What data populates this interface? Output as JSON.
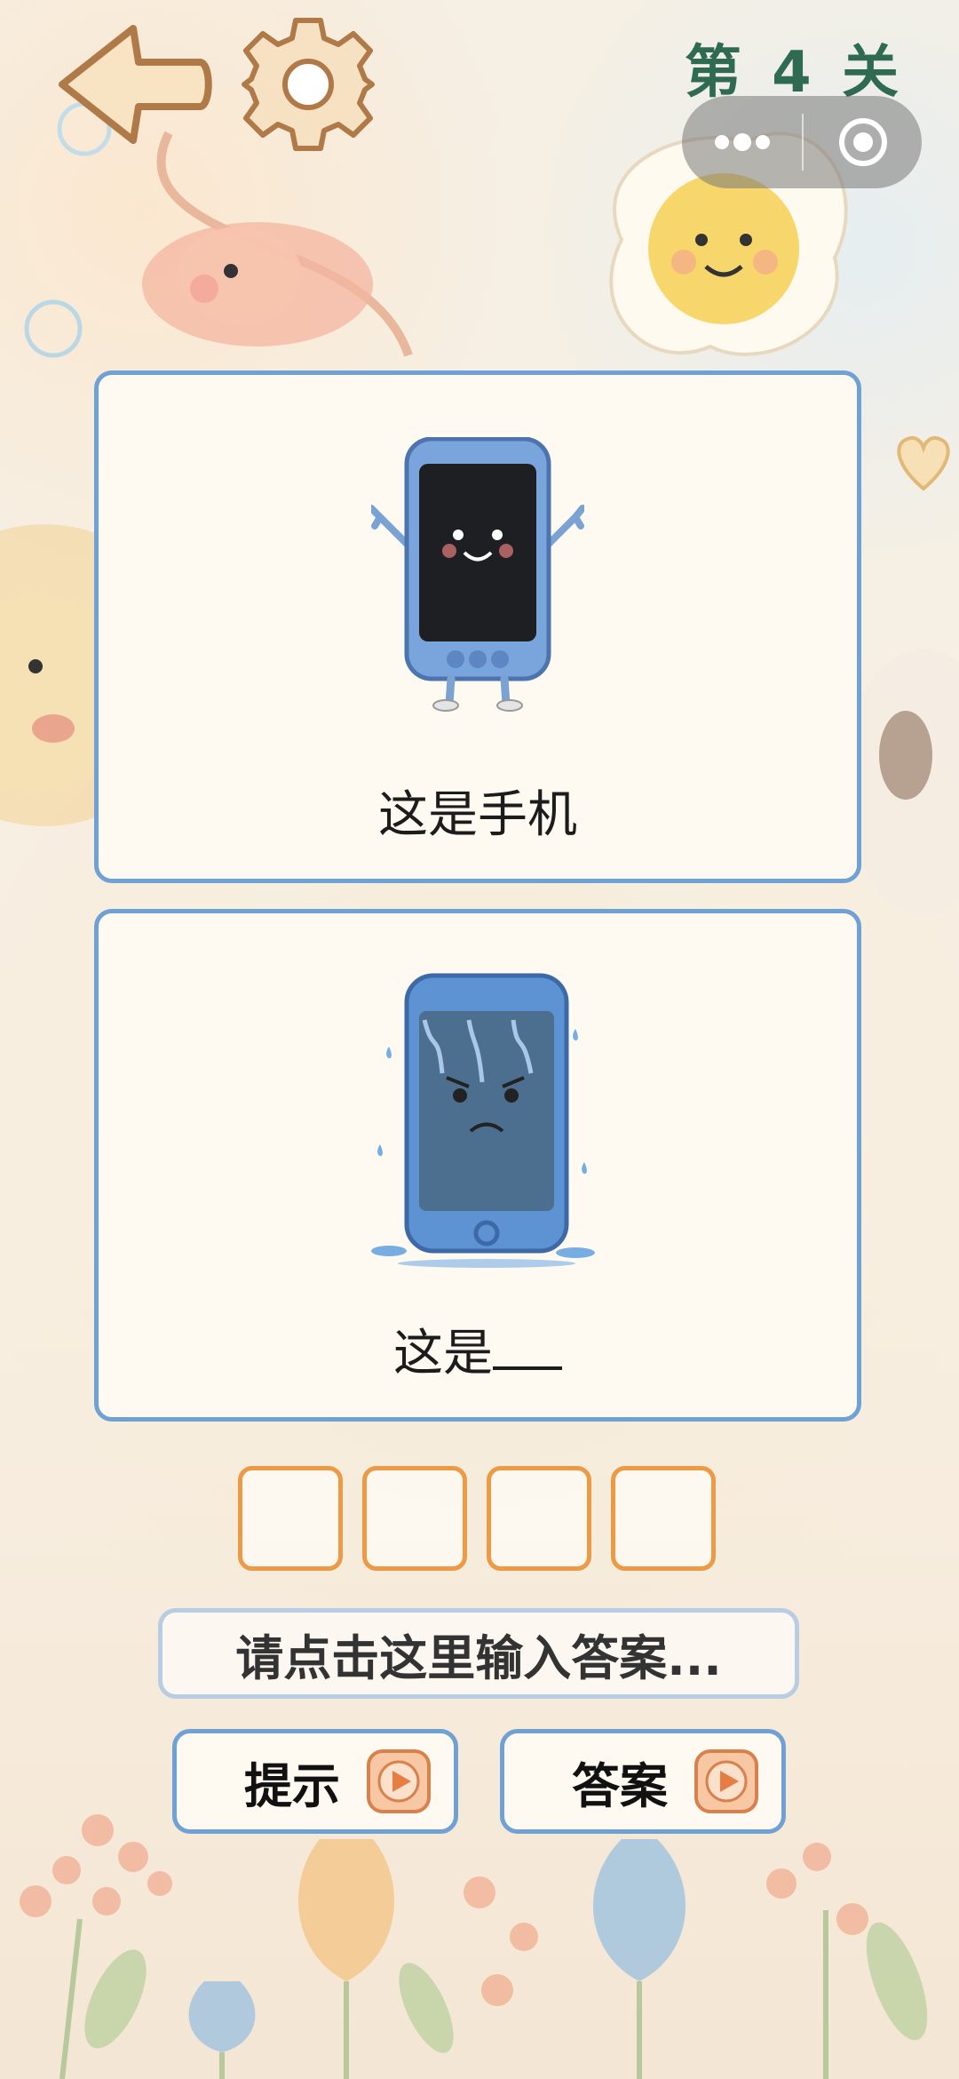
{
  "header": {
    "level_label": "第 4 关",
    "back_icon": "back-arrow-icon",
    "settings_icon": "gear-icon",
    "more_icon": "more-dots-icon",
    "close_icon": "target-close-icon"
  },
  "cards": [
    {
      "image": "happy-phone-illustration",
      "caption": "这是手机"
    },
    {
      "image": "wet-sad-phone-illustration",
      "caption_prefix": "这是"
    }
  ],
  "answer_slots": [
    "",
    "",
    "",
    ""
  ],
  "input": {
    "placeholder": "请点击这里输入答案..."
  },
  "buttons": {
    "hint_label": "提示",
    "answer_label": "答案",
    "play_icon": "video-play-icon"
  },
  "colors": {
    "card_border": "#6fa1d4",
    "slot_border": "#ec9a45",
    "level_text": "#2f6b52"
  }
}
